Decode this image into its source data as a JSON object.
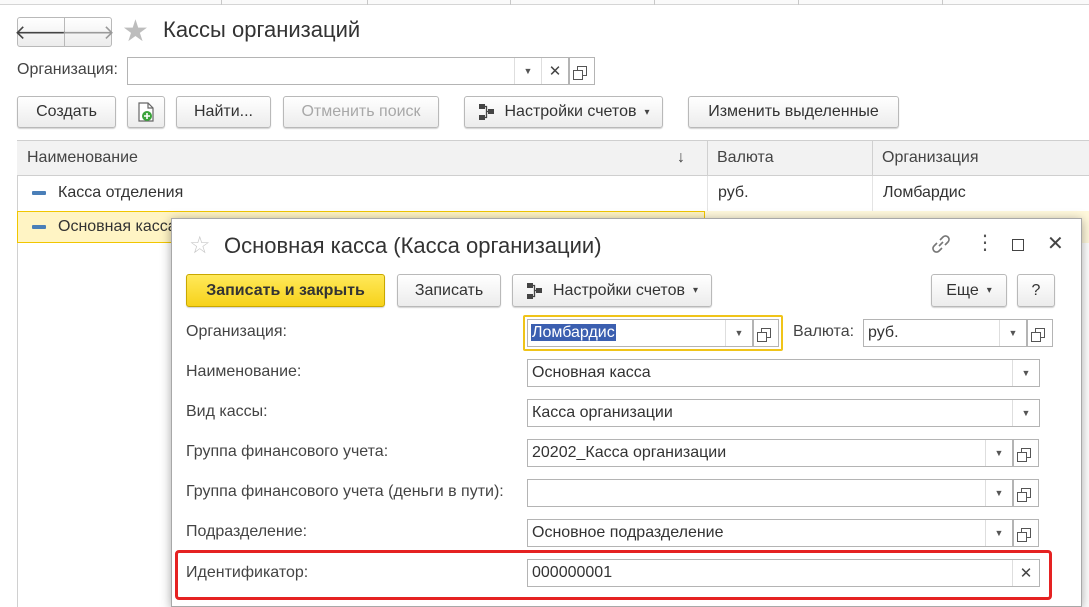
{
  "window": {
    "title": "Кассы организаций",
    "org_label": "Организация:",
    "org_value": ""
  },
  "toolbar": {
    "create": "Создать",
    "find": "Найти...",
    "cancel_search": "Отменить поиск",
    "account_settings": "Настройки счетов",
    "change_selected": "Изменить выделенные"
  },
  "table": {
    "columns": [
      "Наименование",
      "Валюта",
      "Организация"
    ],
    "rows": [
      {
        "name": "Касса отделения",
        "currency": "руб.",
        "org": "Ломбардис"
      },
      {
        "name": "Основная касса",
        "currency": "",
        "org": ""
      }
    ]
  },
  "dialog": {
    "title": "Основная касса (Касса организации)",
    "save_close": "Записать и закрыть",
    "save": "Записать",
    "account_settings": "Настройки счетов",
    "more": "Еще",
    "help": "?",
    "fields": {
      "org_label": "Организация:",
      "org_value": "Ломбардис",
      "currency_label": "Валюта:",
      "currency_value": "руб.",
      "name_label": "Наименование:",
      "name_value": "Основная касса",
      "type_label": "Вид кассы:",
      "type_value": "Касса организации",
      "fin_group_label": "Группа финансового учета:",
      "fin_group_value": "20202_Касса организации",
      "fin_group_transit_label": "Группа финансового учета (деньги в пути):",
      "fin_group_transit_value": "",
      "division_label": "Подразделение:",
      "division_value": "Основное подразделение",
      "id_label": "Идентификатор:",
      "id_value": "000000001"
    }
  },
  "colors": {
    "accent_yellow": "#f7d21a",
    "selection_bg": "#fff4c4",
    "highlight_red": "#e52222",
    "selected_text_bg": "#3b5fb0"
  }
}
